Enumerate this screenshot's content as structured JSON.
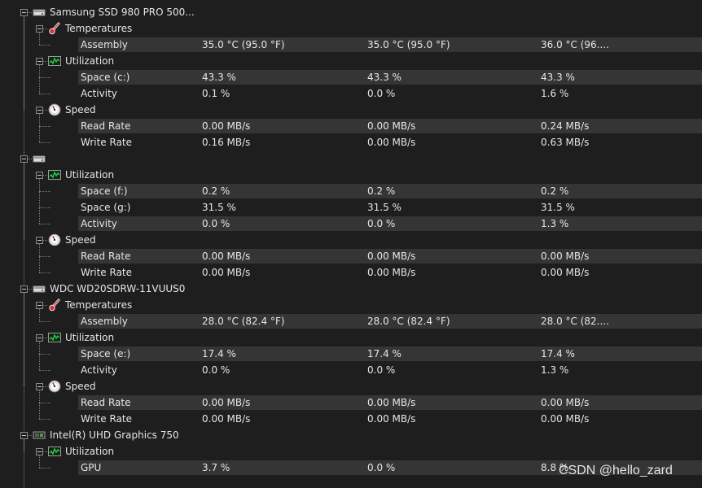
{
  "rows": [
    {
      "level": 0,
      "icon": "drive-icon",
      "label": "Samsung SSD 980 PRO 500...",
      "v1": "",
      "v2": "",
      "v3": ""
    },
    {
      "level": 1,
      "icon": "thermometer-icon",
      "label": "Temperatures",
      "v1": "",
      "v2": "",
      "v3": ""
    },
    {
      "level": 2,
      "label": "Assembly",
      "v1": "35.0 °C  (95.0 °F)",
      "v2": "35.0 °C  (95.0 °F)",
      "v3": "36.0 °C  (96....",
      "band": true
    },
    {
      "level": 1,
      "icon": "utilization-graph-icon",
      "label": "Utilization",
      "v1": "",
      "v2": "",
      "v3": ""
    },
    {
      "level": 2,
      "label": "Space (c:)",
      "v1": "43.3 %",
      "v2": "43.3 %",
      "v3": "43.3 %",
      "band": true
    },
    {
      "level": 2,
      "label": "Activity",
      "v1": "0.1 %",
      "v2": "0.0 %",
      "v3": "1.6 %"
    },
    {
      "level": 1,
      "icon": "speed-gauge-icon",
      "label": "Speed",
      "v1": "",
      "v2": "",
      "v3": ""
    },
    {
      "level": 2,
      "label": "Read Rate",
      "v1": "0.00 MB/s",
      "v2": "0.00 MB/s",
      "v3": "0.24 MB/s",
      "band": true
    },
    {
      "level": 2,
      "label": "Write Rate",
      "v1": "0.16 MB/s",
      "v2": "0.00 MB/s",
      "v3": "0.63 MB/s"
    },
    {
      "level": 0,
      "icon": "drive-icon",
      "label": "",
      "v1": "",
      "v2": "",
      "v3": ""
    },
    {
      "level": 1,
      "icon": "utilization-graph-icon",
      "label": "Utilization",
      "v1": "",
      "v2": "",
      "v3": ""
    },
    {
      "level": 2,
      "label": "Space (f:)",
      "v1": "0.2 %",
      "v2": "0.2 %",
      "v3": "0.2 %",
      "band": true
    },
    {
      "level": 2,
      "label": "Space (g:)",
      "v1": "31.5 %",
      "v2": "31.5 %",
      "v3": "31.5 %"
    },
    {
      "level": 2,
      "label": "Activity",
      "v1": "0.0 %",
      "v2": "0.0 %",
      "v3": "1.3 %",
      "band": true
    },
    {
      "level": 1,
      "icon": "speed-gauge-icon",
      "label": "Speed",
      "v1": "",
      "v2": "",
      "v3": ""
    },
    {
      "level": 2,
      "label": "Read Rate",
      "v1": "0.00 MB/s",
      "v2": "0.00 MB/s",
      "v3": "0.00 MB/s",
      "band": true
    },
    {
      "level": 2,
      "label": "Write Rate",
      "v1": "0.00 MB/s",
      "v2": "0.00 MB/s",
      "v3": "0.00 MB/s"
    },
    {
      "level": 0,
      "icon": "drive-icon",
      "label": "WDC WD20SDRW-11VUUS0",
      "v1": "",
      "v2": "",
      "v3": ""
    },
    {
      "level": 1,
      "icon": "thermometer-icon",
      "label": "Temperatures",
      "v1": "",
      "v2": "",
      "v3": ""
    },
    {
      "level": 2,
      "label": "Assembly",
      "v1": "28.0 °C  (82.4 °F)",
      "v2": "28.0 °C  (82.4 °F)",
      "v3": "28.0 °C  (82....",
      "band": true
    },
    {
      "level": 1,
      "icon": "utilization-graph-icon",
      "label": "Utilization",
      "v1": "",
      "v2": "",
      "v3": ""
    },
    {
      "level": 2,
      "label": "Space (e:)",
      "v1": "17.4 %",
      "v2": "17.4 %",
      "v3": "17.4 %",
      "band": true
    },
    {
      "level": 2,
      "label": "Activity",
      "v1": "0.0 %",
      "v2": "0.0 %",
      "v3": "1.3 %"
    },
    {
      "level": 1,
      "icon": "speed-gauge-icon",
      "label": "Speed",
      "v1": "",
      "v2": "",
      "v3": ""
    },
    {
      "level": 2,
      "label": "Read Rate",
      "v1": "0.00 MB/s",
      "v2": "0.00 MB/s",
      "v3": "0.00 MB/s",
      "band": true
    },
    {
      "level": 2,
      "label": "Write Rate",
      "v1": "0.00 MB/s",
      "v2": "0.00 MB/s",
      "v3": "0.00 MB/s"
    },
    {
      "level": 0,
      "icon": "gpu-card-icon",
      "label": "Intel(R) UHD Graphics 750",
      "v1": "",
      "v2": "",
      "v3": ""
    },
    {
      "level": 1,
      "icon": "utilization-graph-icon",
      "label": "Utilization",
      "v1": "",
      "v2": "",
      "v3": ""
    },
    {
      "level": 2,
      "label": "GPU",
      "v1": "3.7 %",
      "v2": "0.0 %",
      "v3": "8.8 %",
      "band": true
    }
  ],
  "watermark": "CSDN @hello_zard"
}
